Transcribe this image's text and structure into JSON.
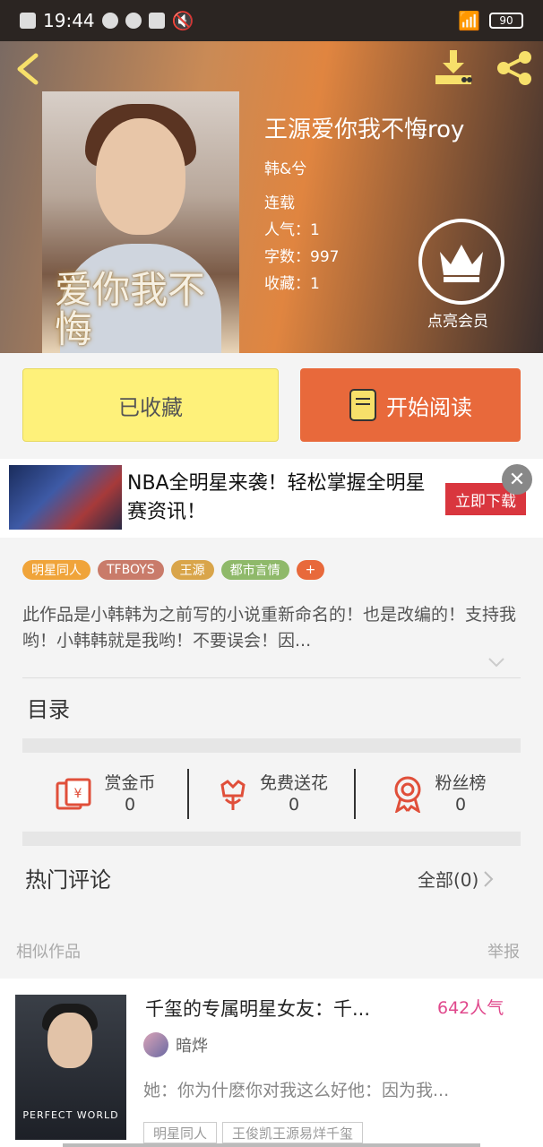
{
  "status": {
    "time": "19:44",
    "battery": "90"
  },
  "book": {
    "title": "王源爱你我不悔roy",
    "cover_title": "爱你我不悔",
    "author": "韩&兮",
    "status": "连载",
    "popularity": "人气：1",
    "word_count": "字数：997",
    "favorites": "收藏：1",
    "vip_label": "点亮会员"
  },
  "actions": {
    "favorite_label": "已收藏",
    "read_label": "开始阅读"
  },
  "ad": {
    "text": "NBA全明星来袭！轻松掌握全明星赛资讯！",
    "button": "立即下载"
  },
  "tags": [
    {
      "label": "明星同人",
      "color": "#f0a43a"
    },
    {
      "label": "TFBOYS",
      "color": "#c97b6a"
    },
    {
      "label": "王源",
      "color": "#d9a54a"
    },
    {
      "label": "都市言情",
      "color": "#8fb96a"
    },
    {
      "label": "+",
      "color": "#e8693b"
    }
  ],
  "description": "此作品是小韩韩为之前写的小说重新命名的！也是改编的！支持我哟！小韩韩就是我哟！不要误会！因...",
  "toc_label": "目录",
  "stats": [
    {
      "label": "赏金币",
      "value": "0",
      "icon": "coin-envelope-icon"
    },
    {
      "label": "免费送花",
      "value": "0",
      "icon": "flower-icon"
    },
    {
      "label": "粉丝榜",
      "value": "0",
      "icon": "ribbon-icon"
    }
  ],
  "comments": {
    "title": "热门评论",
    "all_label": "全部(0)"
  },
  "similar": {
    "title": "相似作品",
    "report": "举报"
  },
  "recommendation": {
    "title": "千玺的专属明星女友：千...",
    "popularity": "642人气",
    "author": "暗烨",
    "description": "她：你为什麽你对我这么好他：因为我...",
    "cover_text": "PERFECT WORLD",
    "tags": [
      "明星同人",
      "王俊凯王源易烊千玺"
    ]
  }
}
